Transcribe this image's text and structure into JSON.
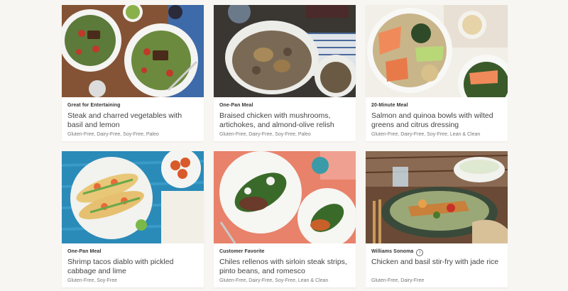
{
  "colors": {
    "page_bg": "#f8f6f2",
    "card_bg": "#ffffff",
    "tag_text": "#333333",
    "title_text": "#444444",
    "diet_text": "#777777"
  },
  "recipes": [
    {
      "tag": "Great for Entertaining",
      "title": "Steak and charred vegetables with basil and lemon",
      "diet": "Gluten-Free, Dairy-Free, Soy-Free, Paleo",
      "image": "steak-plates-photo"
    },
    {
      "tag": "One-Pan Meal",
      "title": "Braised chicken with mushrooms, artichokes, and almond-olive relish",
      "diet": "Gluten-Free, Dairy-Free, Soy-Free, Paleo",
      "image": "braised-chicken-photo"
    },
    {
      "tag": "20-Minute Meal",
      "title": "Salmon and quinoa bowls with wilted greens and citrus dressing",
      "diet": "Gluten-Free, Dairy-Free, Soy-Free, Lean & Clean",
      "image": "salmon-bowl-photo"
    },
    {
      "tag": "One-Pan Meal",
      "title": "Shrimp tacos diablo with pickled cabbage and lime",
      "diet": "Gluten-Free, Soy-Free",
      "image": "shrimp-tacos-photo"
    },
    {
      "tag": "Customer Favorite",
      "title": "Chiles rellenos with sirloin steak strips, pinto beans, and romesco",
      "diet": "Gluten-Free, Dairy-Free, Soy-Free, Lean & Clean",
      "image": "chiles-rellenos-photo"
    },
    {
      "tag": "Williams Sonoma",
      "title": "Chicken and basil stir-fry with jade rice",
      "diet": "Gluten-Free, Dairy-Free",
      "image": "stir-fry-photo",
      "info_icon": "info-icon"
    }
  ]
}
